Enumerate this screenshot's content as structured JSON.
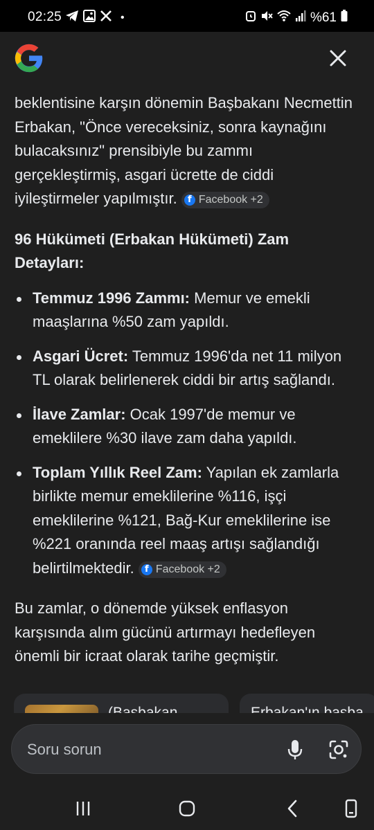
{
  "status_bar": {
    "time": "02:25",
    "left_icons": [
      "telegram-icon",
      "gallery-icon",
      "x-icon"
    ],
    "right_icons": [
      "alarm-icon",
      "mute-icon",
      "wifi-icon",
      "signal-icon"
    ],
    "battery": "%61"
  },
  "header": {
    "logo": "google-logo",
    "close_icon": "close-icon"
  },
  "answer": {
    "intro": "beklentisine karşın dönemin Başbakanı Necmettin Erbakan, \"Önce vereceksiniz, sonra kaynağını bulacaksınız\" prensibiyle bu zammı gerçekleştirmiş, asgari ücrette de ciddi iyileştirmeler yapılmıştır.",
    "intro_source": "Facebook +2",
    "heading": "96 Hükümeti (Erbakan Hükümeti) Zam Detayları:",
    "bullets": [
      {
        "label": "Temmuz 1996 Zammı:",
        "text": " Memur ve emekli maaşlarına %50 zam yapıldı."
      },
      {
        "label": "Asgari Ücret:",
        "text": " Temmuz 1996'da net 11 milyon TL olarak belirlenerek ciddi bir artış sağlandı."
      },
      {
        "label": "İlave Zamlar:",
        "text": " Ocak 1997'de memur ve emeklilere %30 ilave zam daha yapıldı."
      },
      {
        "label": "Toplam Yıllık Reel Zam:",
        "text": " Yapılan ek zamlarla birlikte memur emeklilerine %116, işçi emeklilerine %121, Bağ-Kur emeklilerine ise %221 oranında reel maaş artışı sağlandığı belirtilmektedir."
      }
    ],
    "bullet_source": "Facebook +2",
    "conclusion": "Bu zamlar, o dönemde yüksek enflasyon karşısında alım gücünü artırmayı hedefleyen önemli bir icraat olarak tarihe geçmiştir."
  },
  "cards": [
    {
      "text": "(Başbakan"
    },
    {
      "text": "Erbakan'ın başba"
    }
  ],
  "search": {
    "placeholder": "Soru sorun",
    "mic_icon": "mic-icon",
    "lens_icon": "google-lens-icon"
  },
  "nav": [
    "recent-apps-icon",
    "home-icon",
    "back-icon",
    "screen-rotate-icon"
  ]
}
